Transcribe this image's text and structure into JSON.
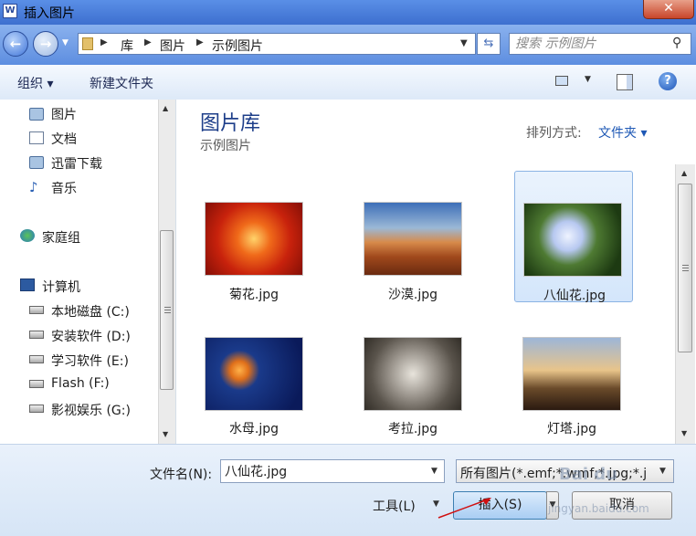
{
  "window": {
    "title": "插入图片",
    "close_label": "✕",
    "app_icon_letter": "W"
  },
  "address": {
    "breadcrumbs": [
      "库",
      "图片",
      "示例图片"
    ],
    "search_placeholder": "搜索 示例图片"
  },
  "toolbar": {
    "organize_label": "组织 ▾",
    "new_folder_label": "新建文件夹",
    "help_label": "?"
  },
  "nav": {
    "libraries": [
      {
        "label": "图片",
        "icon": "picture-library-icon"
      },
      {
        "label": "文档",
        "icon": "document-library-icon"
      },
      {
        "label": "迅雷下载",
        "icon": "download-library-icon"
      },
      {
        "label": "音乐",
        "icon": "music-library-icon"
      }
    ],
    "homegroup": "家庭组",
    "computer": "计算机",
    "drives": [
      "本地磁盘 (C:)",
      "安装软件 (D:)",
      "学习软件 (E:)",
      "Flash (F:)",
      "影视娱乐 (G:)"
    ]
  },
  "library": {
    "title": "图片库",
    "subtitle": "示例图片",
    "sort_label": "排列方式:",
    "sort_value": "文件夹 ▾"
  },
  "files": [
    {
      "name": "菊花.jpg",
      "selected": false
    },
    {
      "name": "沙漠.jpg",
      "selected": false
    },
    {
      "name": "八仙花.jpg",
      "selected": true
    },
    {
      "name": "水母.jpg",
      "selected": false
    },
    {
      "name": "考拉.jpg",
      "selected": false
    },
    {
      "name": "灯塔.jpg",
      "selected": false
    }
  ],
  "bottom": {
    "filename_label": "文件名(N):",
    "filename_value": "八仙花.jpg",
    "filter_value": "所有图片(*.emf;*.wmf;*.jpg;*.j",
    "tools_label": "工具(L)",
    "insert_label": "插入(S)",
    "cancel_label": "取消"
  },
  "watermark": {
    "line1": "Bai du",
    "line2": "jingyan.baidu.com"
  },
  "colors": {
    "title_blue": "#1e3f8a",
    "link_blue": "#1e58b5",
    "selection": "#d4e6fb"
  }
}
